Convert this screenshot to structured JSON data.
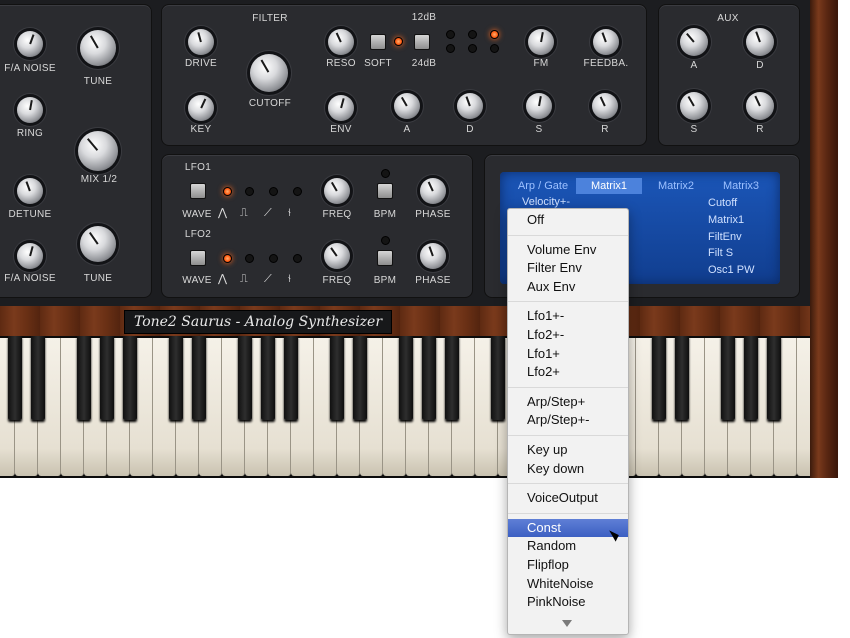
{
  "osc": {
    "fa_noise_1": "F/A NOISE",
    "tune_1": "TUNE",
    "ring": "RING",
    "mix": "MIX 1/2",
    "detune": "DETUNE",
    "fa_noise_2": "F/A NOISE",
    "tune_2": "TUNE"
  },
  "filter": {
    "title": "FILTER",
    "drive": "DRIVE",
    "cutoff": "CUTOFF",
    "reso": "RESO",
    "soft": "SOFT",
    "db12": "12dB",
    "db24": "24dB",
    "fm": "FM",
    "feedback": "FEEDBA.",
    "key": "KEY",
    "env": "ENV",
    "a": "A",
    "d": "D",
    "s": "S",
    "r": "R"
  },
  "aux": {
    "title": "AUX",
    "a": "A",
    "d": "D",
    "s": "S",
    "r": "R"
  },
  "lfo1": {
    "title": "LFO1",
    "wave": "WAVE",
    "freq": "FREQ",
    "bpm": "BPM",
    "phase": "PHASE"
  },
  "lfo2": {
    "title": "LFO2",
    "wave": "WAVE",
    "freq": "FREQ",
    "bpm": "BPM",
    "phase": "PHASE"
  },
  "matrix": {
    "tabs": [
      "Arp / Gate",
      "Matrix1",
      "Matrix2",
      "Matrix3"
    ],
    "active_tab": "Matrix1",
    "source_visible": "Velocity+-",
    "targets": [
      "Cutoff",
      "Matrix1",
      "FiltEnv",
      "Filt S",
      "Osc1 PW"
    ]
  },
  "title_plate": "Tone2 Saurus - Analog Synthesizer",
  "menu": {
    "groups": [
      [
        "Off"
      ],
      [
        "Volume Env",
        "Filter Env",
        "Aux Env"
      ],
      [
        "Lfo1+-",
        "Lfo2+-",
        "Lfo1+",
        "Lfo2+"
      ],
      [
        "Arp/Step+",
        "Arp/Step+-"
      ],
      [
        "Key up",
        "Key down"
      ],
      [
        "VoiceOutput"
      ],
      [
        "Const",
        "Random",
        "Flipflop",
        "WhiteNoise",
        "PinkNoise"
      ]
    ],
    "selected": "Const"
  },
  "colors": {
    "accent_led": "#ff5a10",
    "menu_highlight": "#3c5fc2",
    "screen_blue": "#1b56b8"
  }
}
